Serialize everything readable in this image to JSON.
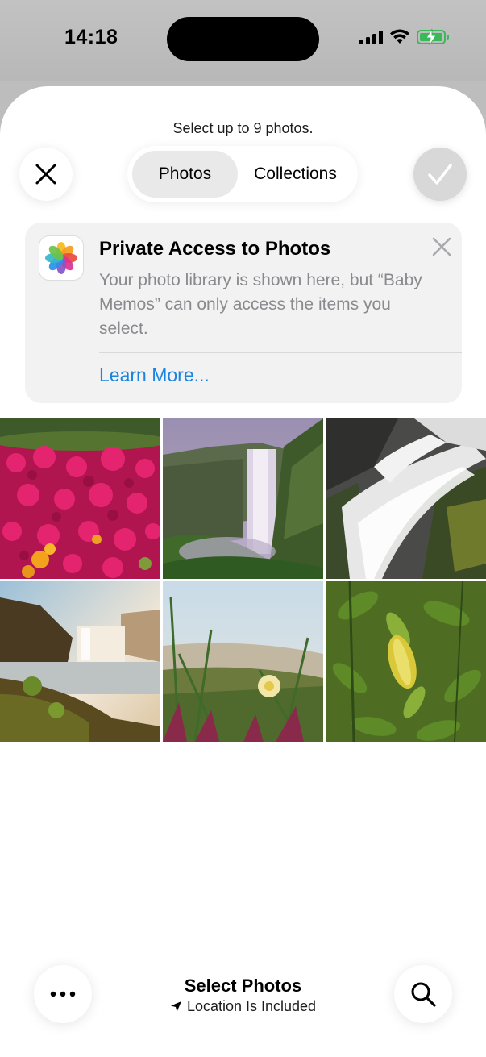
{
  "status_bar": {
    "time": "14:18",
    "icons": [
      "cellular-signal-icon",
      "wifi-icon",
      "battery-charging-icon"
    ],
    "battery_color": "#3bb85a"
  },
  "sheet": {
    "hint": "Select up to 9 photos.",
    "tabs": [
      {
        "label": "Photos",
        "active": true
      },
      {
        "label": "Collections",
        "active": false
      }
    ],
    "close_icon": "close-icon",
    "done_icon": "checkmark-icon"
  },
  "info_card": {
    "icon": "photos-app-icon",
    "title": "Private Access to Photos",
    "body": "Your photo library is shown here, but “Baby Memos” can only access the items you select.",
    "link": "Learn More...",
    "link_color": "#1a84e0"
  },
  "photos": [
    {
      "name": "photo-pink-flowers"
    },
    {
      "name": "photo-waterfall-cliff"
    },
    {
      "name": "photo-waterfall-rocks"
    },
    {
      "name": "photo-waterfall-sunset"
    },
    {
      "name": "photo-beach-grass-flower"
    },
    {
      "name": "photo-green-leaves"
    }
  ],
  "bottom_bar": {
    "title": "Select Photos",
    "subtitle": "Location Is Included",
    "more_icon": "more-icon",
    "location_icon": "location-arrow-icon",
    "search_icon": "search-icon"
  }
}
